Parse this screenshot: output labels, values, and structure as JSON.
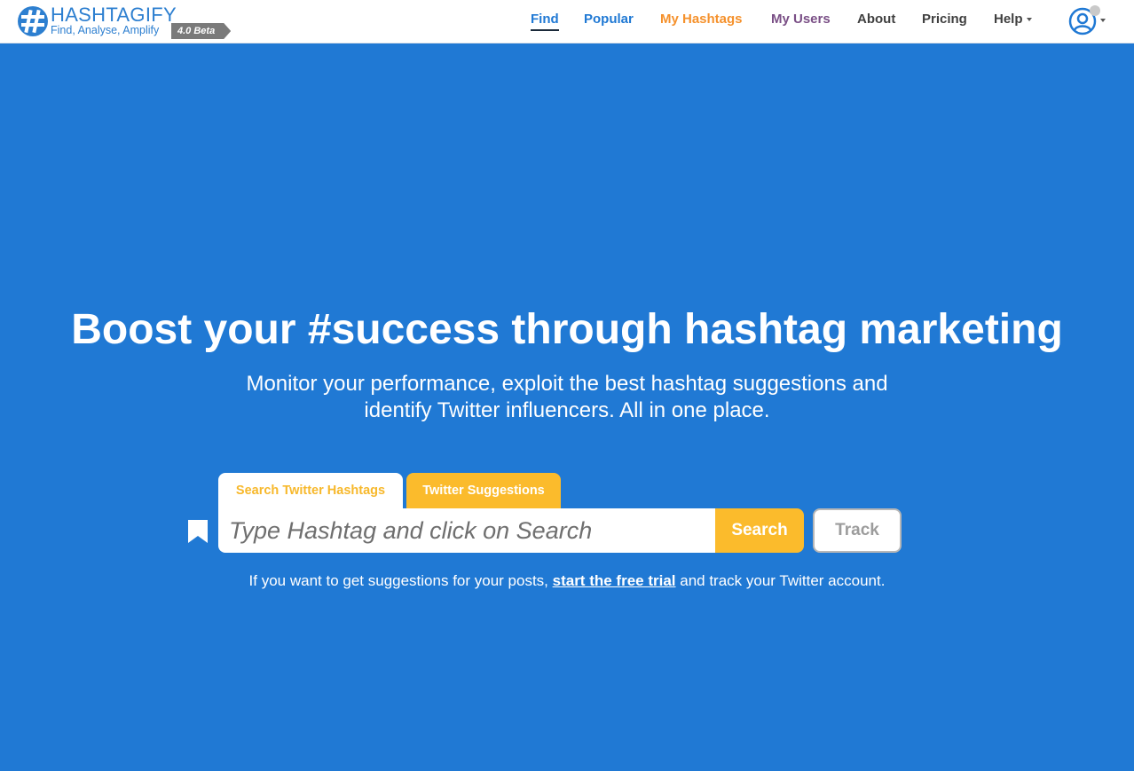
{
  "brand": {
    "name": "HASHTAGIFY",
    "tagline": "Find, Analyse, Amplify",
    "badge": "4.0 Beta",
    "color": "#2d7fd0"
  },
  "nav": {
    "items": [
      {
        "label": "Find",
        "color": "#2079d4",
        "active": true
      },
      {
        "label": "Popular",
        "color": "#2079d4",
        "active": false
      },
      {
        "label": "My Hashtags",
        "color": "#f5912c",
        "active": false
      },
      {
        "label": "My Users",
        "color": "#7a4f86",
        "active": false
      },
      {
        "label": "About",
        "color": "#404040",
        "active": false
      },
      {
        "label": "Pricing",
        "color": "#404040",
        "active": false
      },
      {
        "label": "Help",
        "color": "#404040",
        "active": false,
        "dropdown": true
      }
    ],
    "account_icon": "user-circle-icon"
  },
  "hero": {
    "title": "Boost your #success through hashtag marketing",
    "subtitle_line1": "Monitor your performance, exploit the best hashtag suggestions and",
    "subtitle_line2": "identify Twitter influencers. All in one place.",
    "background": "#2079d4"
  },
  "search": {
    "tabs": [
      {
        "label": "Search Twitter Hashtags",
        "selected": true
      },
      {
        "label": "Twitter Suggestions",
        "selected": false
      }
    ],
    "placeholder": "Type Hashtag and click on Search",
    "value": "",
    "search_label": "Search",
    "track_label": "Track",
    "bookmark_icon": "bookmark-icon",
    "accent": "#fbbb2c"
  },
  "cta": {
    "before": "If you want to get suggestions for your posts, ",
    "link": "start the free trial",
    "after": " and track your Twitter account."
  }
}
